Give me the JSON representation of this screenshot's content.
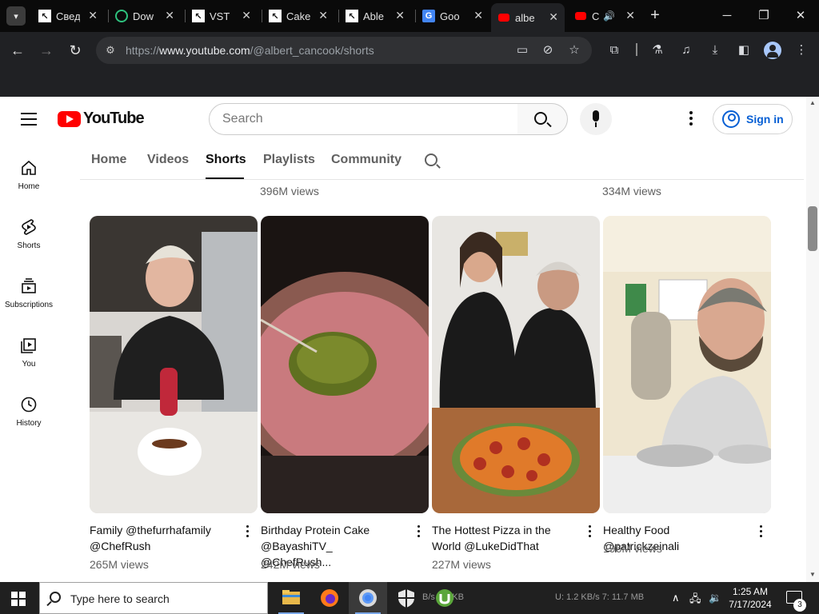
{
  "browser": {
    "tabs": [
      {
        "label": "Свед",
        "favicon": "cursor-favicon"
      },
      {
        "label": "Dow",
        "favicon": "download-favicon"
      },
      {
        "label": "VST",
        "favicon": "cursor-favicon"
      },
      {
        "label": "Cake",
        "favicon": "cursor-favicon"
      },
      {
        "label": "Able",
        "favicon": "cursor-favicon"
      },
      {
        "label": "Goo",
        "favicon": "google-translate-favicon"
      },
      {
        "label": "albe",
        "favicon": "youtube-favicon"
      },
      {
        "label": "C",
        "favicon": "youtube-favicon"
      }
    ],
    "active_tab_index": 6,
    "new_tab_glyph": "+",
    "url_scheme": "https://",
    "url_host": "www.youtube.com",
    "url_path": "/@albert_cancook/shorts"
  },
  "youtube": {
    "logo_text": "YouTube",
    "search_placeholder": "Search",
    "sign_in": "Sign in",
    "sidebar": [
      {
        "label": "Home",
        "icon": "home-icon"
      },
      {
        "label": "Shorts",
        "icon": "shorts-icon"
      },
      {
        "label": "Subscriptions",
        "icon": "subscriptions-icon"
      },
      {
        "label": "You",
        "icon": "you-icon"
      },
      {
        "label": "History",
        "icon": "history-icon"
      }
    ],
    "channel_tabs": [
      "Home",
      "Videos",
      "Shorts",
      "Playlists",
      "Community"
    ],
    "active_channel_tab": "Shorts",
    "prev_row_views": [
      "396M views",
      "334M views"
    ],
    "shorts": [
      {
        "title_line1": "Family @thefurrhafamily",
        "title_line2": "@ChefRush",
        "views": "265M views"
      },
      {
        "title_line1": "Birthday Protein Cake",
        "title_line2": "@BayashiTV_ @ChefRush...",
        "views": "242M views"
      },
      {
        "title_line1": "The Hottest Pizza in the",
        "title_line2": "World @LukeDidThat",
        "views": "227M views"
      },
      {
        "title_line1": "Healthy Food @patrickzeinali",
        "title_line2": "",
        "views": "196M views"
      }
    ]
  },
  "taskbar": {
    "search_placeholder": "Type here to search",
    "net_ghost_left": "B/s  3.4 KB",
    "net_ghost_right": "U: 1.2 KB/s  7: 11.7 MB",
    "time": "1:25 AM",
    "date": "7/17/2024",
    "notification_count": "3"
  },
  "colors": {
    "youtube_red": "#ff0000",
    "link_blue": "#065fd4",
    "chrome_dark": "#202124",
    "taskbar": "#202020"
  }
}
